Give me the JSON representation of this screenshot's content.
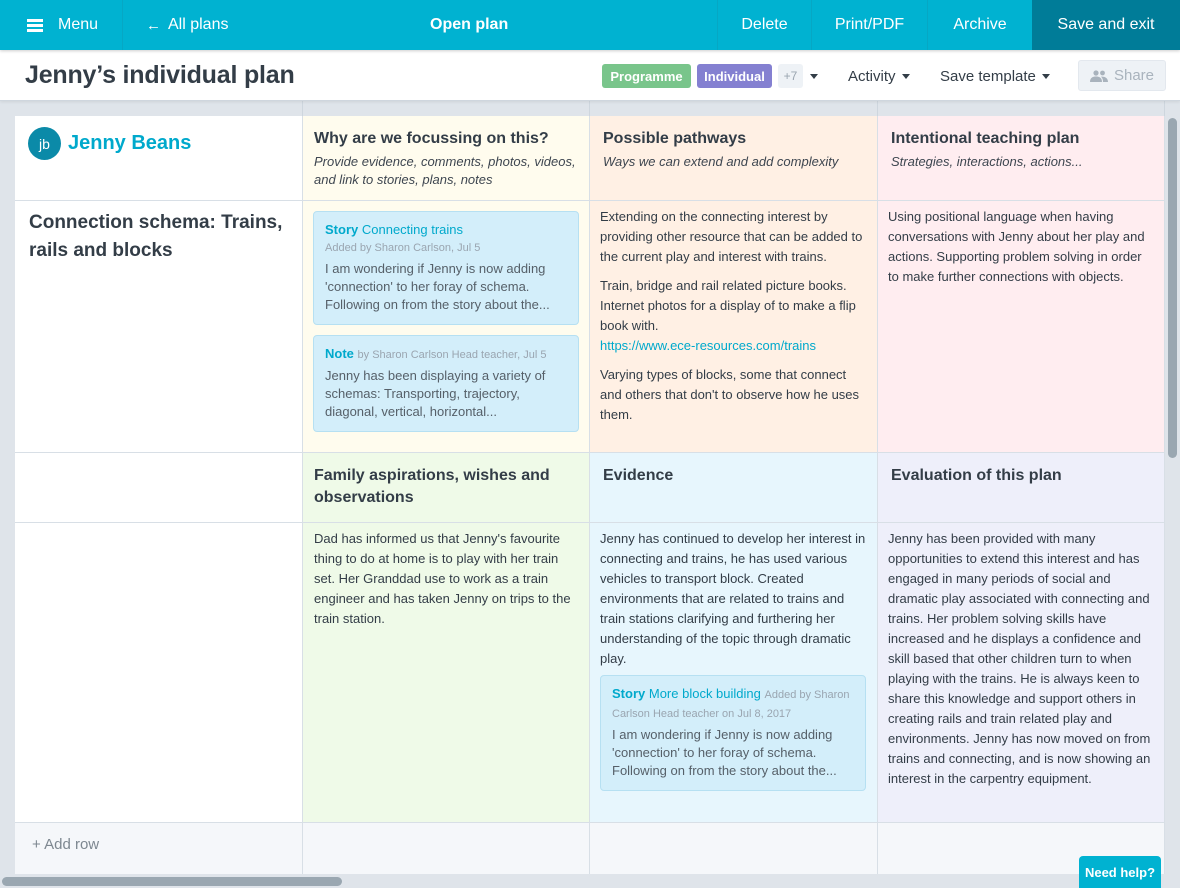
{
  "topbar": {
    "menu_label": "Menu",
    "all_plans_label": "All plans",
    "title": "Open plan",
    "delete_label": "Delete",
    "print_label": "Print/PDF",
    "archive_label": "Archive",
    "save_exit_label": "Save and exit",
    "brand_color": "#00b2d1",
    "save_color": "#007c98"
  },
  "subheader": {
    "title": "Jenny’s individual plan",
    "tags": [
      {
        "label": "Programme",
        "color": "#79c58b"
      },
      {
        "label": "Individual",
        "color": "#8480d1"
      }
    ],
    "more_tags": "+7",
    "activity_label": "Activity",
    "save_template_label": "Save template",
    "share_label": "Share"
  },
  "child": {
    "initials": "jb",
    "name": "Jenny Beans"
  },
  "columns": [
    {
      "heading": "Why are we focussing on this?",
      "subheading": "Provide evidence, comments, photos, videos, and link to stories, plans, notes"
    },
    {
      "heading": "Possible pathways",
      "subheading": "Ways we can extend and add complexity"
    },
    {
      "heading": "Intentional teaching plan",
      "subheading": "Strategies, interactions, actions..."
    }
  ],
  "row1": {
    "title": "Connection schema: Trains, rails and blocks",
    "focus_cards": [
      {
        "type": "Story",
        "title": "Connecting trains",
        "meta": "Added by Sharon Carlson, Jul 5",
        "text": "I am wondering if Jenny is now adding 'connection' to her foray of schema. Following on from the story about the..."
      },
      {
        "type": "Note",
        "title": "",
        "meta": "by Sharon Carlson Head teacher, Jul 5",
        "text": "Jenny has been displaying a variety of schemas: Transporting, trajectory, diagonal, vertical, horizontal..."
      }
    ],
    "pathways": [
      "Extending on the connecting interest by providing other resource that can be added to the current play and interest with trains.",
      "Train, bridge and rail related picture books. Internet photos for a display of to make a flip book with.",
      "Varying types of blocks, some that connect and others that don't to observe how he uses them."
    ],
    "pathways_link": "https://www.ece-resources.com/trains",
    "teaching": "Using positional language when having conversations with Jenny about her play and actions. Supporting problem solving in order to make further connections with objects."
  },
  "columns2": [
    {
      "heading": "Family aspirations, wishes and observations"
    },
    {
      "heading": "Evidence"
    },
    {
      "heading": "Evaluation of this plan"
    }
  ],
  "row2": {
    "family": "Dad has informed us that Jenny's favourite thing to do at home is to play with her train set. Her Granddad use to work as a train engineer and has taken Jenny on trips to the train station.",
    "evidence": "Jenny has continued to develop her interest in connecting and trains, he has used various vehicles to transport block. Created environments that are related to trains and train stations clarifying and furthering her understanding of the topic through dramatic play.",
    "evidence_card": {
      "type": "Story",
      "title": "More block building",
      "meta": "Added by Sharon Carlson Head teacher on Jul 8, 2017",
      "text": "I am wondering if Jenny is now adding 'connection' to her foray of schema. Following on from the story about the..."
    },
    "evaluation": "Jenny has been provided with many opportunities to extend this interest and has engaged in many periods of social and dramatic play associated with connecting and trains. Her problem solving skills have increased and he displays a confidence and skill based that other children turn to when playing with the trains. He is always keen to share this knowledge and support others in creating rails and train related play and environments. Jenny has now moved on from trains and connecting, and is now showing an interest in the carpentry equipment."
  },
  "add_row_label": "+ Add row",
  "help_label": "Need help?"
}
